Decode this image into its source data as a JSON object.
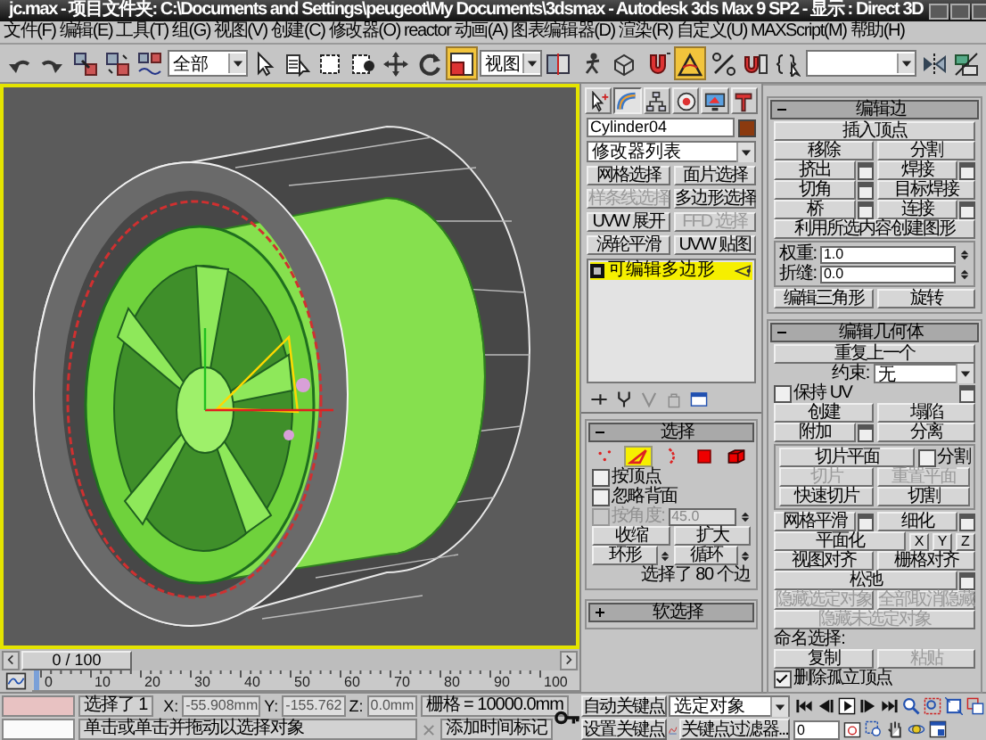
{
  "window": {
    "title": "jc.max - 项目文件夹: C:\\Documents and Settings\\peugeot\\My Documents\\3dsmax - Autodesk 3ds Max 9 SP2 - 显示 : Direct 3D"
  },
  "menu": [
    "文件(F)",
    "编辑(E)",
    "工具(T)",
    "组(G)",
    "视图(V)",
    "创建(C)",
    "修改器(O)",
    "reactor",
    "动画(A)",
    "图表编辑器(D)",
    "渲染(R)",
    "自定义(U)",
    "MAXScript(M)",
    "帮助(H)"
  ],
  "toolbar": [
    {
      "kind": "button",
      "selected": false
    },
    {
      "kind": "button",
      "selected": false
    },
    {
      "kind": "button",
      "selected": false
    },
    {
      "kind": "button",
      "selected": false
    },
    {
      "kind": "button",
      "selected": false
    },
    {
      "kind": "dropdown",
      "value": "全部"
    },
    {
      "kind": "button",
      "selected": false
    },
    {
      "kind": "button",
      "selected": false
    },
    {
      "kind": "button",
      "selected": false
    },
    {
      "kind": "button",
      "selected": false
    },
    {
      "kind": "button",
      "selected": false
    },
    {
      "kind": "button",
      "selected": false
    },
    {
      "kind": "button",
      "selected": true
    },
    {
      "kind": "dropdown",
      "value": "视图"
    },
    {
      "kind": "button",
      "selected": false
    },
    {
      "kind": "button",
      "selected": false
    },
    {
      "kind": "button",
      "selected": false
    },
    {
      "kind": "button",
      "selected": false
    },
    {
      "kind": "button",
      "selected": true
    },
    {
      "kind": "button",
      "selected": false
    },
    {
      "kind": "button",
      "selected": false
    },
    {
      "kind": "button",
      "selected": false
    },
    {
      "kind": "dropdown"
    },
    {
      "kind": "button",
      "selected": false
    },
    {
      "kind": "button",
      "selected": false
    }
  ],
  "command_panel": {
    "tabs": [
      {
        "selected": false
      },
      {
        "selected": true
      },
      {
        "selected": false
      },
      {
        "selected": false
      },
      {
        "selected": false
      },
      {
        "selected": false
      }
    ],
    "object": {
      "name": "Cylinder04",
      "color": "#8b3a0f"
    },
    "modifier_list": "修改器列表",
    "modifier_buttons": [
      {
        "label": "网格选择",
        "disabled": false
      },
      {
        "label": "面片选择",
        "disabled": false
      },
      {
        "label": "样条线选择",
        "disabled": true
      },
      {
        "label": "多边形选择",
        "disabled": false
      },
      {
        "label": "UVW 展开",
        "disabled": false
      },
      {
        "label": "FFD 选择",
        "disabled": true
      },
      {
        "label": "涡轮平滑",
        "disabled": false
      },
      {
        "label": "UVW 贴图",
        "disabled": false
      }
    ],
    "stack": [
      {
        "label": "可编辑多边形",
        "selected": true,
        "expanded": false
      }
    ],
    "stack_tools": [
      {
        "disabled": false
      },
      {
        "disabled": false
      },
      {
        "disabled": true
      },
      {
        "disabled": true
      },
      {
        "disabled": false
      }
    ],
    "rollouts": [
      {
        "title": "选择",
        "expanded": true,
        "rows": [
          {
            "items": [
              {
                "kind": "subobject",
                "selected": false
              },
              {
                "kind": "subobject",
                "selected": true
              },
              {
                "kind": "subobject",
                "selected": false
              },
              {
                "kind": "subobject",
                "selected": false
              },
              {
                "kind": "subobject",
                "selected": false
              }
            ]
          },
          {
            "items": [
              {
                "kind": "checkbox",
                "label": "按顶点",
                "checked": false,
                "disabled": false
              }
            ]
          },
          {
            "items": [
              {
                "kind": "checkbox",
                "label": "忽略背面",
                "checked": false,
                "disabled": false
              }
            ]
          },
          {
            "items": [
              {
                "kind": "checkbox",
                "label": "按角度:",
                "checked": false,
                "disabled": true
              },
              {
                "kind": "spinner",
                "value": "45.0",
                "disabled": true
              }
            ]
          },
          {
            "items": [
              {
                "kind": "button",
                "label": "收缩",
                "disabled": false
              },
              {
                "kind": "button",
                "label": "扩大",
                "disabled": false
              }
            ]
          },
          {
            "items": [
              {
                "kind": "button",
                "label": "环形",
                "disabled": false,
                "spinner": true
              },
              {
                "kind": "button",
                "label": "循环",
                "disabled": false,
                "spinner": true
              }
            ]
          },
          {
            "items": [
              {
                "kind": "count",
                "label": "选择了 80 个边"
              }
            ]
          }
        ]
      },
      {
        "title": "软选择",
        "expanded": false
      }
    ]
  },
  "edit_panel": {
    "rollouts": [
      {
        "title": "编辑边",
        "expanded": true,
        "rows": [
          {
            "items": [
              {
                "kind": "button",
                "label": "插入顶点",
                "disabled": false
              }
            ]
          },
          {
            "items": [
              {
                "kind": "button",
                "label": "移除",
                "disabled": false
              },
              {
                "kind": "button",
                "label": "分割",
                "disabled": false
              }
            ]
          },
          {
            "items": [
              {
                "kind": "button",
                "label": "挤出",
                "disabled": false,
                "settings": true
              },
              {
                "kind": "button",
                "label": "焊接",
                "disabled": false,
                "settings": true
              }
            ]
          },
          {
            "items": [
              {
                "kind": "button",
                "label": "切角",
                "disabled": false,
                "settings": true
              },
              {
                "kind": "button",
                "label": "目标焊接",
                "disabled": false
              }
            ]
          },
          {
            "items": [
              {
                "kind": "button",
                "label": "桥",
                "disabled": false,
                "settings": true
              },
              {
                "kind": "button",
                "label": "连接",
                "disabled": false,
                "settings": true
              }
            ]
          },
          {
            "items": [
              {
                "kind": "button",
                "label": "利用所选内容创建图形",
                "disabled": false
              }
            ]
          },
          {
            "group": [
              {
                "items": [
                  {
                    "kind": "spinner",
                    "label": "权重:",
                    "value": "1.0",
                    "disabled": false
                  }
                ]
              },
              {
                "items": [
                  {
                    "kind": "spinner",
                    "label": "折缝:",
                    "value": "0.0",
                    "disabled": false
                  }
                ]
              }
            ]
          },
          {
            "items": [
              {
                "kind": "button",
                "label": "编辑三角形",
                "disabled": false
              },
              {
                "kind": "button",
                "label": "旋转",
                "disabled": false
              }
            ]
          }
        ]
      },
      {
        "title": "编辑几何体",
        "expanded": true,
        "rows": [
          {
            "items": [
              {
                "kind": "button",
                "label": "重复上一个",
                "disabled": false
              }
            ]
          },
          {
            "items": [
              {
                "kind": "dropdown",
                "label": "约束:",
                "value": "无"
              }
            ]
          },
          {
            "items": [
              {
                "kind": "checkbox",
                "label": "保持 UV",
                "checked": false,
                "disabled": false,
                "settings": true
              }
            ]
          },
          {
            "items": [
              {
                "kind": "button",
                "label": "创建",
                "disabled": false
              },
              {
                "kind": "button",
                "label": "塌陷",
                "disabled": false
              }
            ]
          },
          {
            "items": [
              {
                "kind": "button",
                "label": "附加",
                "disabled": false,
                "settings": true
              },
              {
                "kind": "button",
                "label": "分离",
                "disabled": false
              }
            ]
          },
          {
            "group": [
              {
                "items": [
                  {
                    "kind": "button",
                    "label": "切片平面",
                    "disabled": false
                  },
                  {
                    "kind": "checkbox",
                    "label": "分割",
                    "checked": false,
                    "disabled": false
                  }
                ]
              },
              {
                "items": [
                  {
                    "kind": "button",
                    "label": "切片",
                    "disabled": true
                  },
                  {
                    "kind": "button",
                    "label": "重置平面",
                    "disabled": true
                  }
                ]
              },
              {
                "items": [
                  {
                    "kind": "button",
                    "label": "快速切片",
                    "disabled": false
                  },
                  {
                    "kind": "button",
                    "label": "切割",
                    "disabled": false
                  }
                ]
              }
            ]
          },
          {
            "items": [
              {
                "kind": "button",
                "label": "网格平滑",
                "disabled": false,
                "settings": true
              },
              {
                "kind": "button",
                "label": "细化",
                "disabled": false,
                "settings": true
              }
            ]
          },
          {
            "items": [
              {
                "kind": "button",
                "label": "平面化",
                "disabled": false
              },
              {
                "kind": "axis",
                "label": "X"
              },
              {
                "kind": "axis",
                "label": "Y"
              },
              {
                "kind": "axis",
                "label": "Z"
              }
            ]
          },
          {
            "items": [
              {
                "kind": "button",
                "label": "视图对齐",
                "disabled": false
              },
              {
                "kind": "button",
                "label": "栅格对齐",
                "disabled": false
              }
            ]
          },
          {
            "items": [
              {
                "kind": "button",
                "label": "松弛",
                "disabled": false,
                "settings": true
              }
            ]
          },
          {
            "items": [
              {
                "kind": "button",
                "label": "隐藏选定对象",
                "disabled": true
              },
              {
                "kind": "button",
                "label": "全部取消隐藏",
                "disabled": true
              }
            ]
          },
          {
            "items": [
              {
                "kind": "button",
                "label": "隐藏未选定对象",
                "disabled": true
              }
            ]
          },
          {
            "items": [
              {
                "kind": "label",
                "label": "命名选择:"
              }
            ]
          },
          {
            "items": [
              {
                "kind": "button",
                "label": "复制",
                "disabled": false
              },
              {
                "kind": "button",
                "label": "粘贴",
                "disabled": true
              }
            ]
          },
          {
            "items": [
              {
                "kind": "checkbox",
                "label": "删除孤立顶点",
                "checked": true,
                "disabled": false
              }
            ]
          }
        ]
      }
    ]
  },
  "time_slider": {
    "label": "0 / 100",
    "level": 0
  },
  "track_bar": {
    "ticks": [
      "0",
      "10",
      "20",
      "30",
      "40",
      "50",
      "60",
      "70",
      "80",
      "90",
      "100"
    ]
  },
  "status_bar": {
    "selection": "选择了 1",
    "coords": [
      {
        "label": "X:",
        "value": "-55.908mm"
      },
      {
        "label": "Y:",
        "value": "-155.762"
      },
      {
        "label": "Z:",
        "value": "0.0mm"
      }
    ],
    "grid": "栅格 = 10000.0mm",
    "prompt": "单击或单击并拖动以选择对象",
    "time_tag": "添加时间标记",
    "auto_key": {
      "label": "自动关键点",
      "on": false
    },
    "set_key": "设置关键点",
    "key_mode": "选定对象",
    "key_filters": "关键点过滤器...",
    "frame": "0"
  }
}
